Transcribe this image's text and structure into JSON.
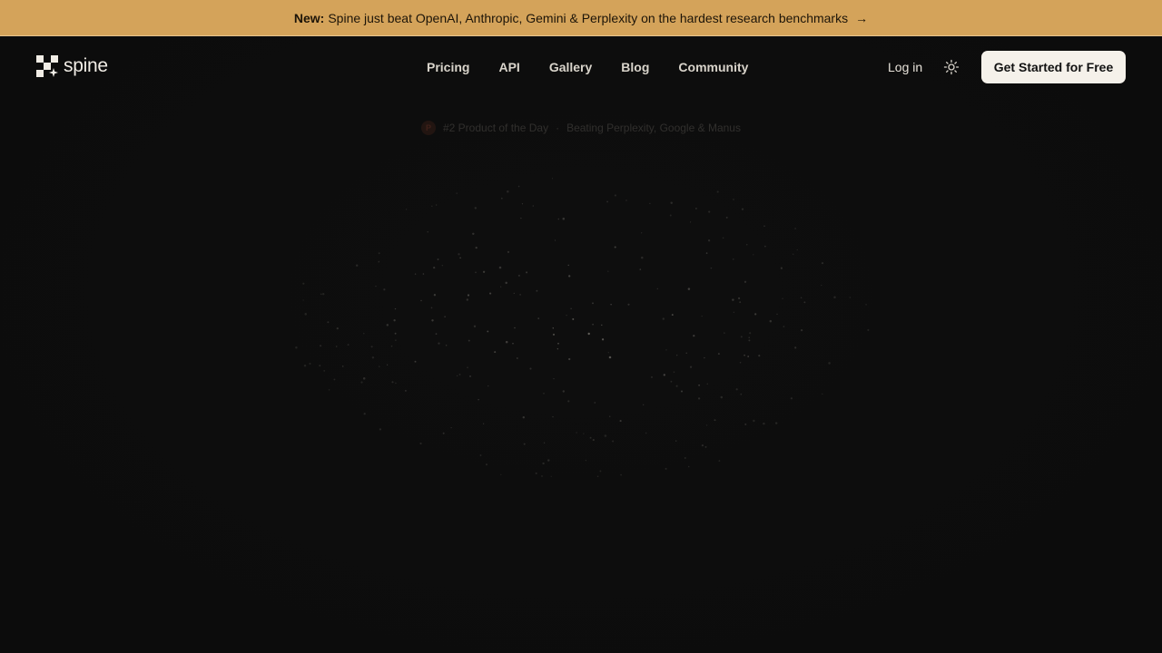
{
  "banner": {
    "prefix": "New:",
    "text": "Spine just beat OpenAI, Anthropic, Gemini & Perplexity on the hardest research benchmarks",
    "arrow": "→",
    "color": "#d4a35a"
  },
  "brand": {
    "name": "spine"
  },
  "nav": {
    "items": [
      {
        "label": "Pricing"
      },
      {
        "label": "API"
      },
      {
        "label": "Gallery"
      },
      {
        "label": "Blog"
      },
      {
        "label": "Community"
      }
    ]
  },
  "header": {
    "login_label": "Log in",
    "theme_icon": "sun-icon",
    "cta_label": "Get Started for Free"
  },
  "badge": {
    "icon_letter": "P",
    "product_text": "#2 Product of the Day",
    "separator": "·",
    "detail_text": "Beating Perplexity, Google & Manus"
  },
  "colors": {
    "background": "#0e0e0e",
    "accent": "#d4a35a",
    "cta_bg": "#f5f1ea"
  }
}
